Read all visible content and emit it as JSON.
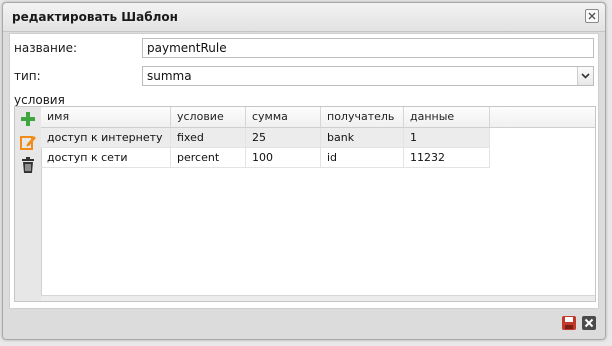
{
  "window": {
    "title": "редактировать Шаблон"
  },
  "form": {
    "name_label": "название:",
    "name_value": "paymentRule",
    "type_label": "тип:",
    "type_value": "summa",
    "conditions_label": "условия"
  },
  "grid": {
    "columns": [
      "имя",
      "условие",
      "сумма",
      "получатель",
      "данные"
    ],
    "rows": [
      [
        "доступ к интернету",
        "fixed",
        "25",
        "bank",
        "1"
      ],
      [
        "доступ к сети",
        "percent",
        "100",
        "id",
        "11232"
      ]
    ]
  },
  "icons": {
    "add": "plus-icon",
    "edit": "edit-icon",
    "delete": "trash-icon",
    "save": "save-icon",
    "cancel": "close-icon",
    "window_close": "close-icon"
  },
  "colors": {
    "add_green": "#3fa63f",
    "edit_orange": "#f08c1a",
    "save_red": "#c0392b",
    "selected_row": "#ececec"
  }
}
